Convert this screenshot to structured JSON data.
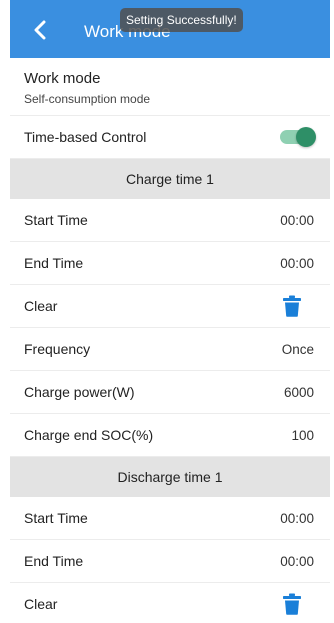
{
  "header": {
    "title": "Work mode",
    "toast": "Setting Successfully!"
  },
  "mode": {
    "title": "Work mode",
    "subtitle": "Self-consumption mode"
  },
  "time_control": {
    "label": "Time-based Control",
    "enabled": true
  },
  "charge": {
    "section_title": "Charge time 1",
    "start_label": "Start Time",
    "start_value": "00:00",
    "end_label": "End Time",
    "end_value": "00:00",
    "clear_label": "Clear",
    "frequency_label": "Frequency",
    "frequency_value": "Once",
    "power_label": "Charge power(W)",
    "power_value": "6000",
    "soc_label": "Charge end SOC(%)",
    "soc_value": "100"
  },
  "discharge": {
    "section_title": "Discharge time 1",
    "start_label": "Start Time",
    "start_value": "00:00",
    "end_label": "End Time",
    "end_value": "00:00",
    "clear_label": "Clear"
  },
  "colors": {
    "header": "#3a8fe0",
    "toggle_on": "#2e8f67",
    "trash": "#1a7fd8",
    "section_bg": "#e3e3e3"
  },
  "icons": {
    "back": "chevron-left-icon",
    "clear": "trash-icon"
  }
}
